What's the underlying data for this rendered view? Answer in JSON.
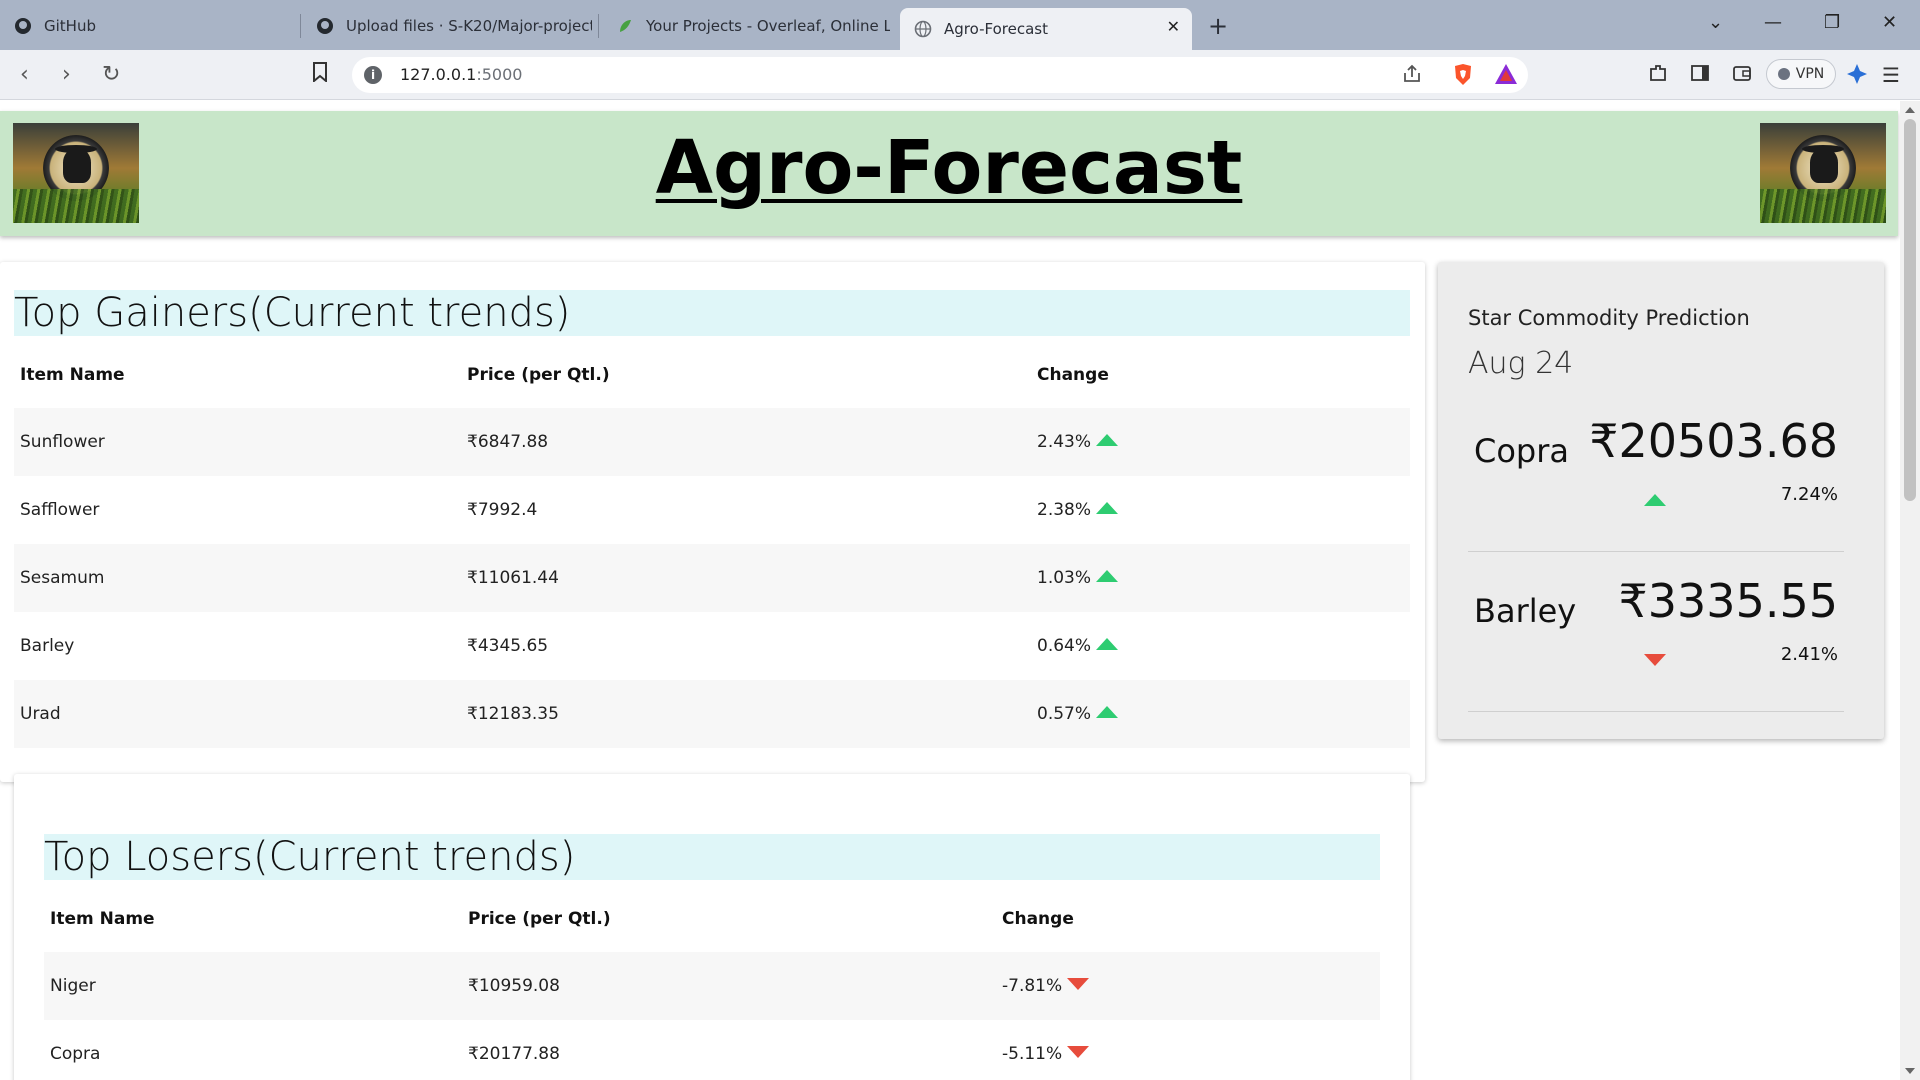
{
  "browser": {
    "tabs": [
      {
        "title": "GitHub",
        "icon": "github-icon"
      },
      {
        "title": "Upload files · S-K20/Major-project-",
        "icon": "github-icon"
      },
      {
        "title": "Your Projects - Overleaf, Online LaTe",
        "icon": "overleaf-icon"
      },
      {
        "title": "Agro-Forecast",
        "icon": "globe-icon",
        "active": true
      }
    ],
    "url_host": "127.0.0.1",
    "url_port": ":5000",
    "vpn_label": "VPN"
  },
  "header": {
    "title": "Agro-Forecast",
    "header_bg": "#c8e6c9"
  },
  "gainers": {
    "title": "Top Gainers(Current trends)",
    "columns": [
      "Item Name",
      "Price (per Qtl.)",
      "Change"
    ],
    "rows": [
      {
        "name": "Sunflower",
        "price": "₹6847.88",
        "change": "2.43%"
      },
      {
        "name": "Safflower",
        "price": "₹7992.4",
        "change": "2.38%"
      },
      {
        "name": "Sesamum",
        "price": "₹11061.44",
        "change": "1.03%"
      },
      {
        "name": "Barley",
        "price": "₹4345.65",
        "change": "0.64%"
      },
      {
        "name": "Urad",
        "price": "₹12183.35",
        "change": "0.57%"
      }
    ],
    "trend_color": "#2ecc71"
  },
  "losers": {
    "title": "Top Losers(Current trends)",
    "columns": [
      "Item Name",
      "Price (per Qtl.)",
      "Change"
    ],
    "rows": [
      {
        "name": "Niger",
        "price": "₹10959.08",
        "change": "-7.81%"
      },
      {
        "name": "Copra",
        "price": "₹20177.88",
        "change": "-5.11%"
      }
    ],
    "trend_color": "#e74c3c"
  },
  "star": {
    "title": "Star Commodity Prediction",
    "date": "Aug 24",
    "items": [
      {
        "name": "Copra",
        "price": "₹20503.68",
        "change": "7.24%",
        "direction": "up"
      },
      {
        "name": "Barley",
        "price": "₹3335.55",
        "change": "2.41%",
        "direction": "down"
      }
    ]
  }
}
